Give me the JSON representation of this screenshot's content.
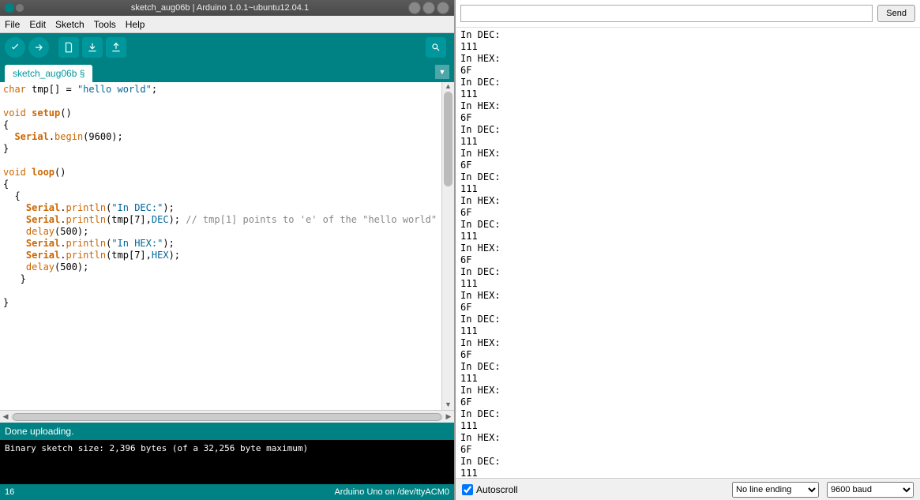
{
  "window": {
    "title": "sketch_aug06b | Arduino 1.0.1~ubuntu12.04.1"
  },
  "menu": [
    "File",
    "Edit",
    "Sketch",
    "Tools",
    "Help"
  ],
  "tab": "sketch_aug06b §",
  "code": {
    "l1_char": "char",
    "l1_var": " tmp[] = ",
    "l1_str": "\"hello world\"",
    "l1_end": ";",
    "l3_void": "void",
    "l3_setup": " setup",
    "l3_p": "()",
    "l5_ser": "Serial",
    "l5_dot": ".",
    "l5_begin": "begin",
    "l5_arg": "(9600);",
    "l8_void": "void",
    "l8_loop": " loop",
    "l8_p": "()",
    "l11_ser": "Serial",
    "l11_dot": ".",
    "l11_m": "println",
    "l11_a": "(",
    "l11_str": "\"In DEC:\"",
    "l11_e": ");",
    "l12_ser": "Serial",
    "l12_dot": ".",
    "l12_m": "println",
    "l12_a": "(tmp[7],",
    "l12_c": "DEC",
    "l12_e": "); ",
    "l12_cmt": "// tmp[1] points to 'e' of the \"hello world\"",
    "l13_d": "delay",
    "l13_a": "(500);",
    "l14_ser": "Serial",
    "l14_dot": ".",
    "l14_m": "println",
    "l14_a": "(",
    "l14_str": "\"In HEX:\"",
    "l14_e": ");",
    "l15_ser": "Serial",
    "l15_dot": ".",
    "l15_m": "println",
    "l15_a": "(tmp[7],",
    "l15_c": "HEX",
    "l15_e": ");",
    "l16_d": "delay",
    "l16_a": "(500);"
  },
  "status": "Done uploading.",
  "console": "Binary sketch size: 2,396 bytes (of a 32,256 byte maximum)",
  "footer": {
    "line": "16",
    "board": "Arduino Uno on /dev/ttyACM0"
  },
  "monitor": {
    "send": "Send",
    "autoscroll": "Autoscroll",
    "line_ending": "No line ending",
    "baud": "9600 baud",
    "output": "In DEC:\n111\nIn HEX:\n6F\nIn DEC:\n111\nIn HEX:\n6F\nIn DEC:\n111\nIn HEX:\n6F\nIn DEC:\n111\nIn HEX:\n6F\nIn DEC:\n111\nIn HEX:\n6F\nIn DEC:\n111\nIn HEX:\n6F\nIn DEC:\n111\nIn HEX:\n6F\nIn DEC:\n111\nIn HEX:\n6F\nIn DEC:\n111\nIn HEX:\n6F\nIn DEC:\n111\nIn HEX:\n6F\nIn DEC:\n111\nIn HEX:\n6F\nIn DEC:\n111"
  }
}
